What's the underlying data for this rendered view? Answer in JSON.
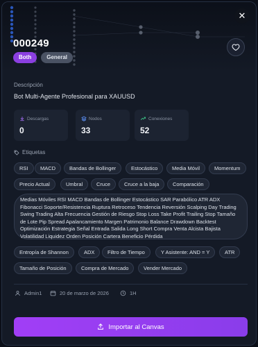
{
  "header": {
    "title": "000249",
    "badges": [
      "Both",
      "General"
    ],
    "close_icon": "close-icon",
    "favorite_icon": "heart-icon"
  },
  "description": {
    "label": "Descripción",
    "text": "Bot Multi-Agente Profesional para XAUUSD"
  },
  "stats": [
    {
      "label": "Descargas",
      "value": "0",
      "icon": "download-icon",
      "color": "#a06cf0"
    },
    {
      "label": "Nodos",
      "value": "33",
      "icon": "layers-icon",
      "color": "#5a8df0"
    },
    {
      "label": "Conexiones",
      "value": "52",
      "icon": "trend-icon",
      "color": "#3fcf8e"
    }
  ],
  "tags": {
    "label": "Etiquetas",
    "row1": [
      "RSI",
      "MACD",
      "Bandas de Bollinger",
      "Estocástico",
      "Media Móvil",
      "Momentum"
    ],
    "row2": [
      "Precio Actual",
      "Umbral",
      "Cruce",
      "Cruce a la baja",
      "Comparación"
    ],
    "long": "Medias Móviles RSI MACD Bandas de Bollinger Estocástico SAR Parabólico ATR ADX Fibonacci Soporte/Resistencia Ruptura Retroceso Tendencia Reversión Scalping Day Trading Swing Trading Alta Frecuencia Gestión de Riesgo Stop Loss Take Profit Trailing Stop Tamaño de Lote Pip Spread Apalancamiento Margen Patrimonio Balance Drawdown Backtest Optimización Estrategia Señal Entrada Salida Long Short Compra Venta Alcista Bajista Volatilidad Liquidez Orden Posición Cartera Beneficio Pérdida",
    "row3": [
      "Entropía de Shannon",
      "ADX",
      "Filtro de Tiempo",
      "Y Asistente: AND = Y",
      "ATR"
    ],
    "row4": [
      "Tamaño de Posición",
      "Compra de Mercado",
      "Vender Mercado"
    ]
  },
  "meta": {
    "author": "Admin1",
    "date": "20 de marzo de 2026",
    "timeframe": "1H"
  },
  "import_button": "Importar al Canvas"
}
